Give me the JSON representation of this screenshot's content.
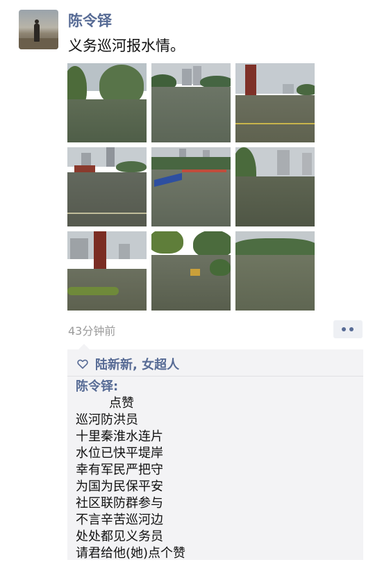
{
  "post": {
    "author": "陈令铎",
    "text": "义务巡河报水情。",
    "timestamp": "43分钟前",
    "photos": [
      {
        "name": "photo-1",
        "alt": "flooded park with willow trees"
      },
      {
        "name": "photo-2",
        "alt": "flooded riverside with buildings"
      },
      {
        "name": "photo-3",
        "alt": "flooded plaza with red tower"
      },
      {
        "name": "photo-4",
        "alt": "flooded river with pavilion"
      },
      {
        "name": "photo-5",
        "alt": "flooded river with blue barriers"
      },
      {
        "name": "photo-6",
        "alt": "flooded riverside with trees and towers"
      },
      {
        "name": "photo-7",
        "alt": "flooded walkway with red tower"
      },
      {
        "name": "photo-8",
        "alt": "flooded path with sign"
      },
      {
        "name": "photo-9",
        "alt": "flooded river with green banks"
      }
    ]
  },
  "likes": {
    "icon": "heart-outline-icon",
    "names": "陆新新, 女超人"
  },
  "comment": {
    "author": "陈令铎:",
    "lines": [
      "点赞",
      "巡河防洪员",
      "十里秦淮水连片",
      "水位已快平堤岸",
      "幸有军民严把守",
      "为国为民保平安",
      "社区联防群参与",
      "不言辛苦巡河边",
      "处处都见义务员",
      "请君给他(她)点个赞"
    ]
  },
  "colors": {
    "link": "#576b95",
    "timestamp": "#9b9b9b",
    "comment_bg": "#f3f3f5"
  }
}
